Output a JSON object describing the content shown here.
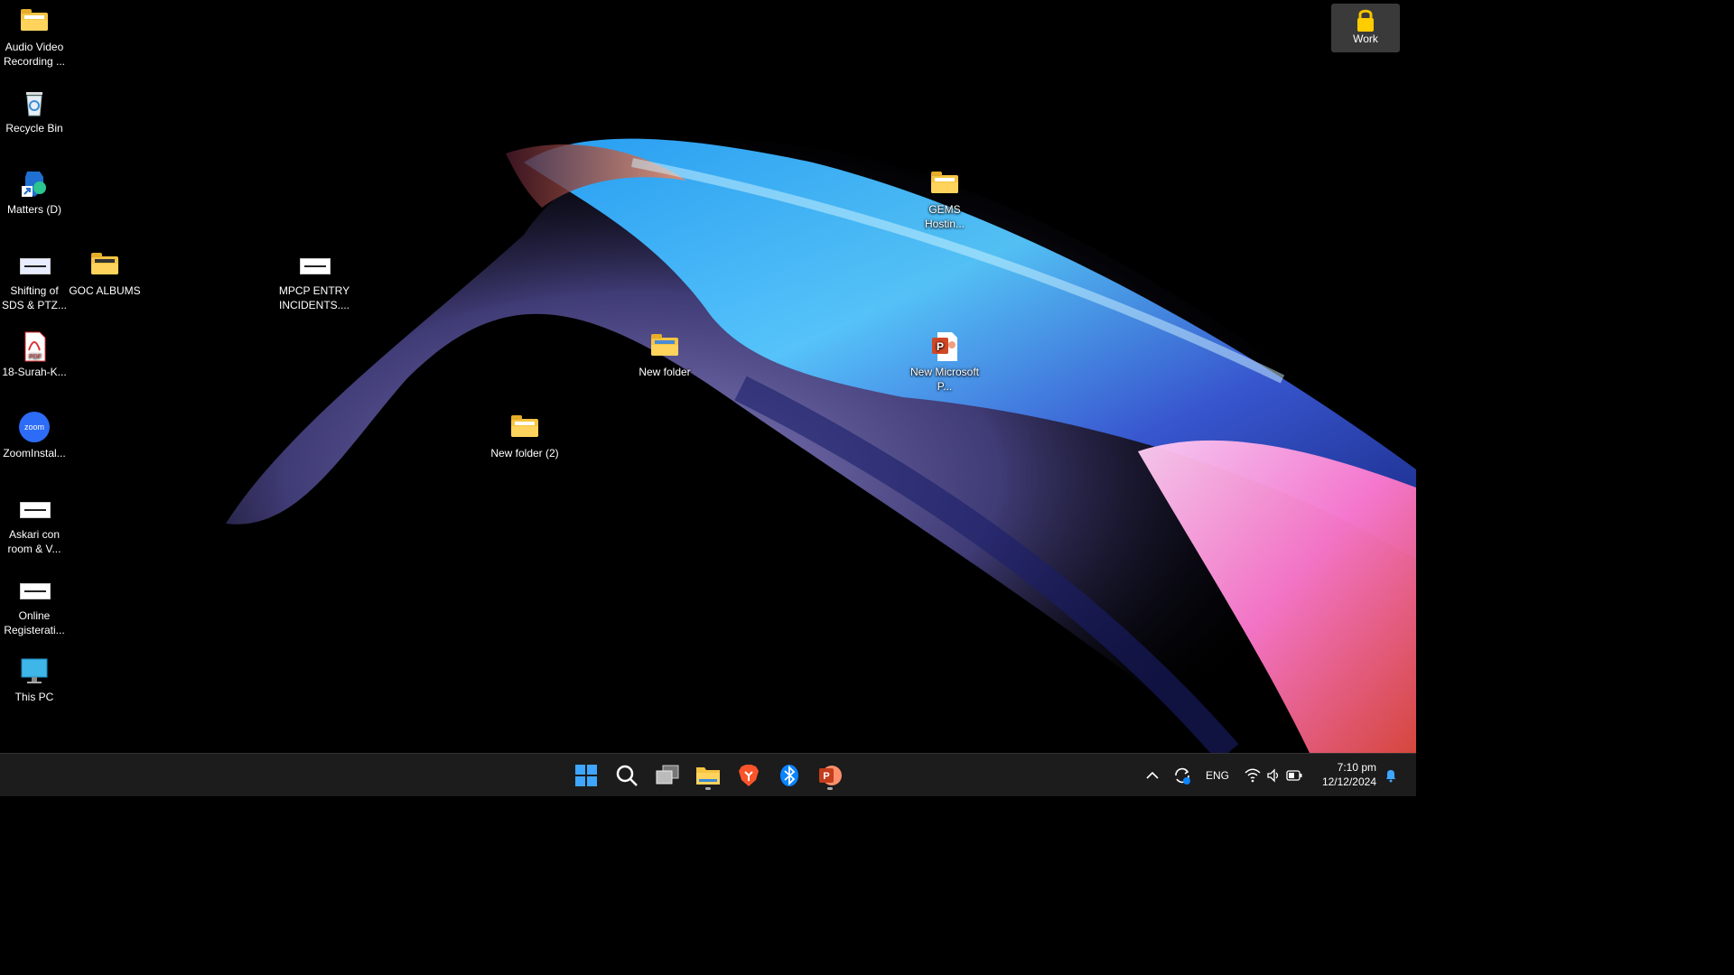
{
  "desktop": {
    "icons": {
      "audio": "Audio Video Recording ...",
      "recycle": "Recycle Bin",
      "matters": "Matters (D)",
      "shifting": "Shifting of SDS & PTZ...",
      "goc": "GOC ALBUMS",
      "mpcp": "MPCP ENTRY INCIDENTS....",
      "surah": "18-Surah-K...",
      "zoom": "ZoomInstal...",
      "askari": "Askari con room & V...",
      "online": "Online Registerati...",
      "thispc": "This PC",
      "gems": "GEMS Hostin...",
      "newfolder": "New folder",
      "newfolder2": "New folder (2)",
      "newppt": "New Microsoft P..."
    },
    "zoom_glyph": "zoom",
    "pdf_glyph": "PDF",
    "ppt_glyph": "P"
  },
  "work_button": {
    "label": "Work"
  },
  "taskbar": {
    "tray": {
      "language": "ENG",
      "time": "7:10 pm",
      "date": "12/12/2024"
    }
  },
  "colors": {
    "taskbar_bg": "#1c1c1c",
    "folder": "#f5c542",
    "windows_blue": "#3ea6ff",
    "powerpoint": "#d24726",
    "brave": "#fb542b",
    "bluetooth": "#0a84ff"
  }
}
